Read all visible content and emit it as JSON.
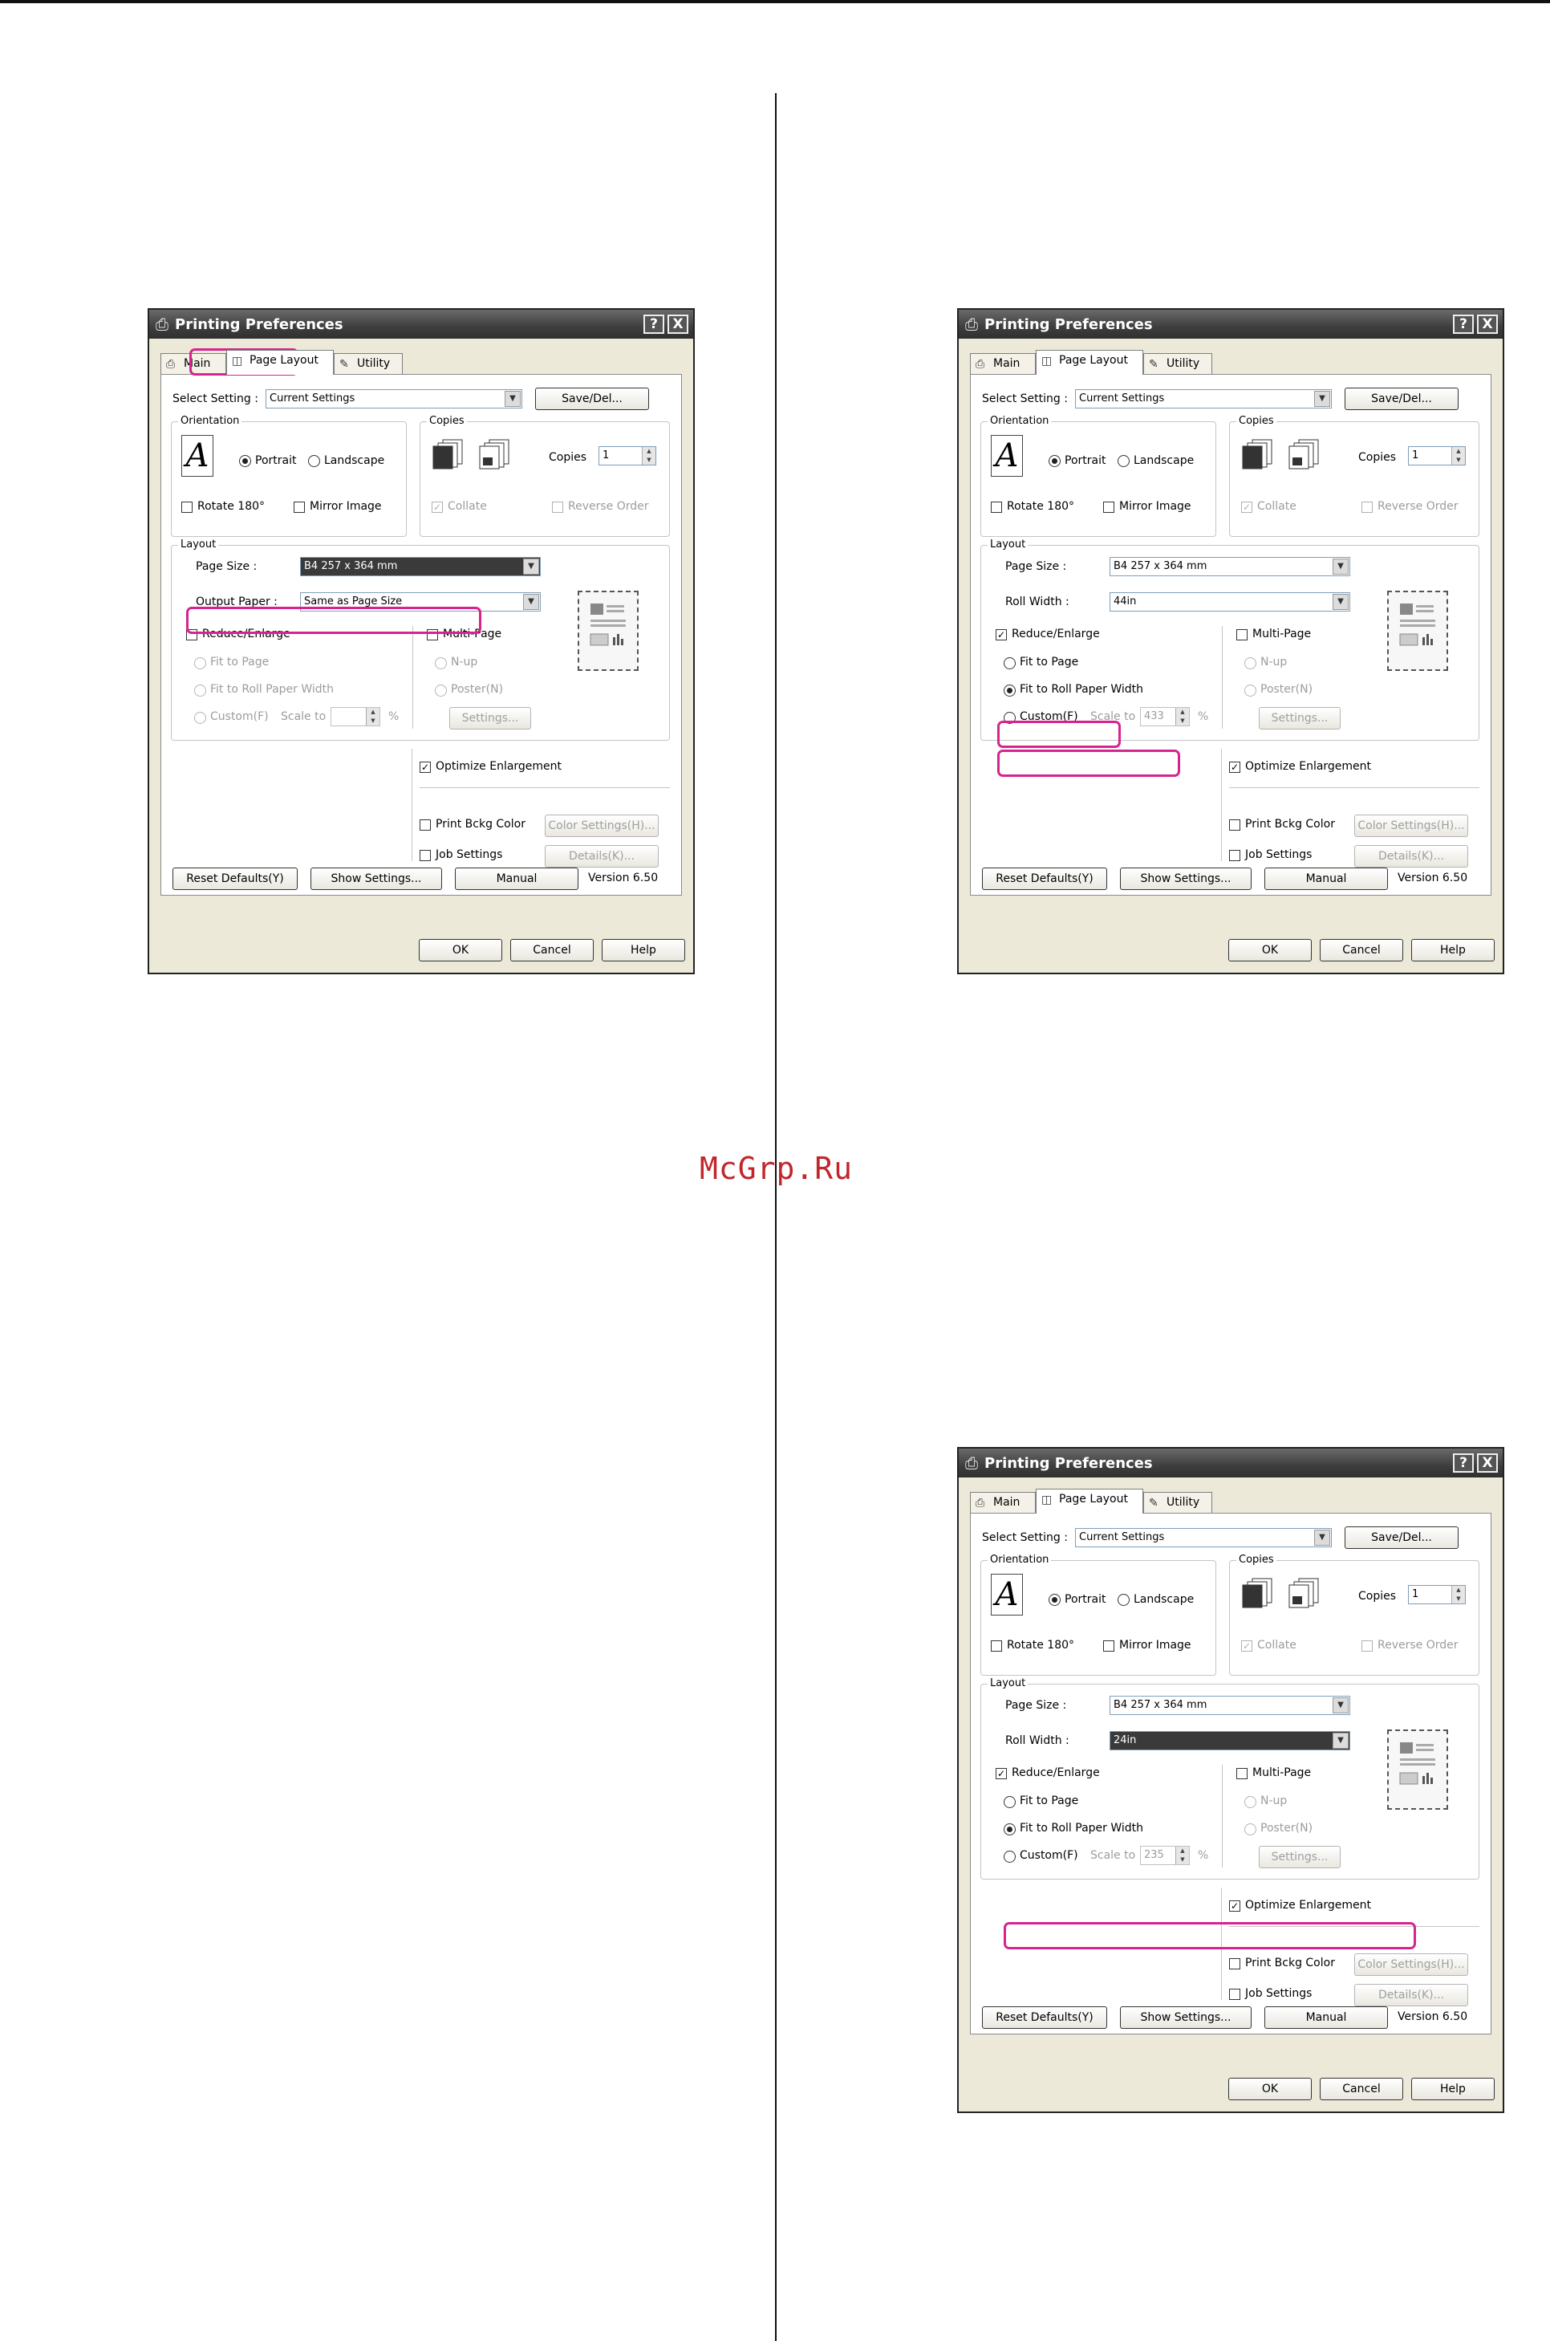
{
  "watermark": "McGrp.Ru",
  "dialogs": [
    {
      "title": "Printing Preferences",
      "help_button": "?",
      "close_button": "X",
      "tabs": {
        "main": "Main",
        "page_layout": "Page Layout",
        "utility": "Utility"
      },
      "select_setting_label": "Select Setting :",
      "select_setting_value": "Current Settings",
      "save_del": "Save/Del...",
      "orientation_title": "Orientation",
      "orientation_icon_glyph": "A",
      "portrait": "Portrait",
      "landscape": "Landscape",
      "rotate_180": "Rotate 180°",
      "mirror_image": "Mirror Image",
      "copies_title": "Copies",
      "copies_label": "Copies",
      "copies_value": "1",
      "collate": "Collate",
      "reverse_order": "Reverse Order",
      "layout_title": "Layout",
      "page_size_label": "Page Size :",
      "page_size_value": "B4 257 x 364 mm",
      "second_label": "Output Paper :",
      "second_value": "Same as Page Size",
      "reduce_enlarge": "Reduce/Enlarge",
      "reduce_checked": false,
      "fit_to_page": "Fit to Page",
      "fit_to_roll": "Fit to Roll Paper Width",
      "custom": "Custom(F)",
      "scale_to": "Scale to",
      "scale_value": "",
      "percent": "%",
      "multi_page": "Multi-Page",
      "n_up": "N-up",
      "poster": "Poster(N)",
      "settings_button": "Settings...",
      "optimize_enlargement": "Optimize Enlargement",
      "print_bckg_color": "Print Bckg Color",
      "color_settings": "Color Settings(H)...",
      "job_settings": "Job Settings",
      "details": "Details(K)...",
      "reset_defaults": "Reset Defaults(Y)",
      "show_settings": "Show Settings...",
      "manual": "Manual",
      "version": "Version 6.50",
      "ok": "OK",
      "cancel": "Cancel",
      "help": "Help"
    },
    {
      "title": "Printing Preferences",
      "help_button": "?",
      "close_button": "X",
      "tabs": {
        "main": "Main",
        "page_layout": "Page Layout",
        "utility": "Utility"
      },
      "select_setting_label": "Select Setting :",
      "select_setting_value": "Current Settings",
      "save_del": "Save/Del...",
      "orientation_title": "Orientation",
      "orientation_icon_glyph": "A",
      "portrait": "Portrait",
      "landscape": "Landscape",
      "rotate_180": "Rotate 180°",
      "mirror_image": "Mirror Image",
      "copies_title": "Copies",
      "copies_label": "Copies",
      "copies_value": "1",
      "collate": "Collate",
      "reverse_order": "Reverse Order",
      "layout_title": "Layout",
      "page_size_label": "Page Size :",
      "page_size_value": "B4 257 x 364 mm",
      "second_label": "Roll Width :",
      "second_value": "44in",
      "reduce_enlarge": "Reduce/Enlarge",
      "reduce_checked": true,
      "fit_to_page": "Fit to Page",
      "fit_to_roll": "Fit to Roll Paper Width",
      "custom": "Custom(F)",
      "scale_to": "Scale to",
      "scale_value": "433",
      "percent": "%",
      "multi_page": "Multi-Page",
      "n_up": "N-up",
      "poster": "Poster(N)",
      "settings_button": "Settings...",
      "optimize_enlargement": "Optimize Enlargement",
      "print_bckg_color": "Print Bckg Color",
      "color_settings": "Color Settings(H)...",
      "job_settings": "Job Settings",
      "details": "Details(K)...",
      "reset_defaults": "Reset Defaults(Y)",
      "show_settings": "Show Settings...",
      "manual": "Manual",
      "version": "Version 6.50",
      "ok": "OK",
      "cancel": "Cancel",
      "help": "Help"
    },
    {
      "title": "Printing Preferences",
      "help_button": "?",
      "close_button": "X",
      "tabs": {
        "main": "Main",
        "page_layout": "Page Layout",
        "utility": "Utility"
      },
      "select_setting_label": "Select Setting :",
      "select_setting_value": "Current Settings",
      "save_del": "Save/Del...",
      "orientation_title": "Orientation",
      "orientation_icon_glyph": "A",
      "portrait": "Portrait",
      "landscape": "Landscape",
      "rotate_180": "Rotate 180°",
      "mirror_image": "Mirror Image",
      "copies_title": "Copies",
      "copies_label": "Copies",
      "copies_value": "1",
      "collate": "Collate",
      "reverse_order": "Reverse Order",
      "layout_title": "Layout",
      "page_size_label": "Page Size :",
      "page_size_value": "B4 257 x 364 mm",
      "second_label": "Roll Width :",
      "second_value": "24in",
      "reduce_enlarge": "Reduce/Enlarge",
      "reduce_checked": true,
      "fit_to_page": "Fit to Page",
      "fit_to_roll": "Fit to Roll Paper Width",
      "custom": "Custom(F)",
      "scale_to": "Scale to",
      "scale_value": "235",
      "percent": "%",
      "multi_page": "Multi-Page",
      "n_up": "N-up",
      "poster": "Poster(N)",
      "settings_button": "Settings...",
      "optimize_enlargement": "Optimize Enlargement",
      "print_bckg_color": "Print Bckg Color",
      "color_settings": "Color Settings(H)...",
      "job_settings": "Job Settings",
      "details": "Details(K)...",
      "reset_defaults": "Reset Defaults(Y)",
      "show_settings": "Show Settings...",
      "manual": "Manual",
      "version": "Version 6.50",
      "ok": "OK",
      "cancel": "Cancel",
      "help": "Help"
    }
  ],
  "colors": {
    "highlight": "#d6248f",
    "watermark": "#c0272d",
    "titlebar": "#3e3e3e"
  },
  "icons": {
    "main_tab": "printer-icon",
    "page_layout_tab": "page-icon",
    "utility_tab": "wrench-icon",
    "title": "printer-icon"
  }
}
